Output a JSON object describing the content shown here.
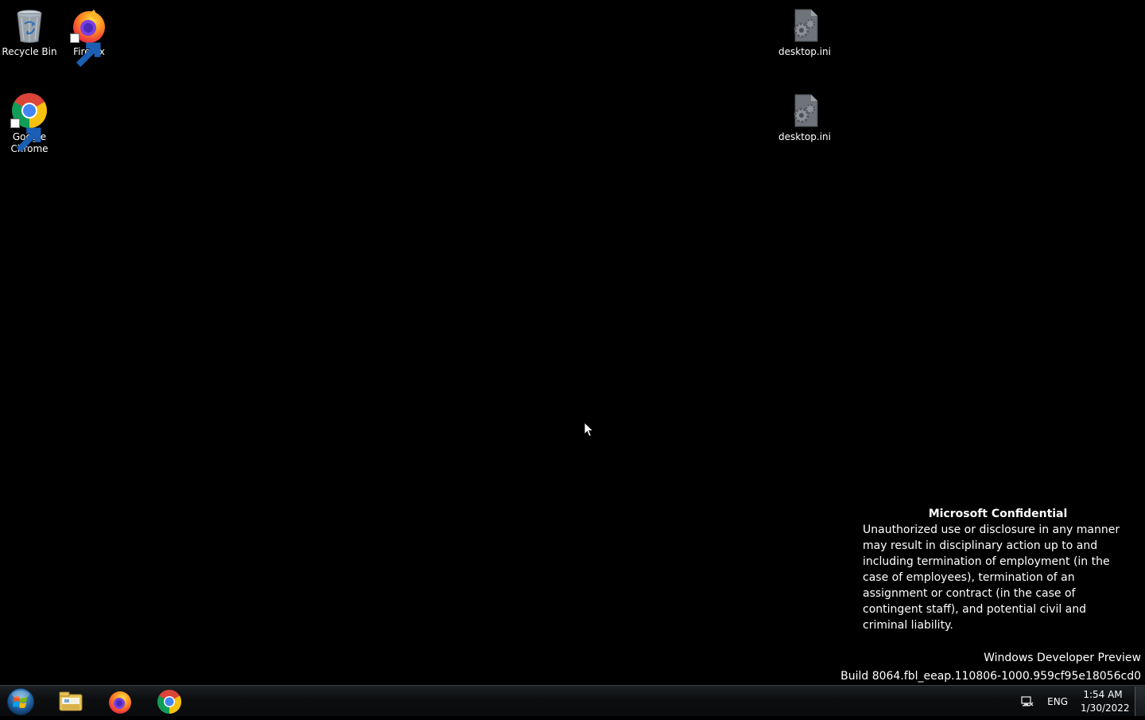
{
  "desktop_icons": {
    "recycle_bin": "Recycle Bin",
    "firefox": "Firefox",
    "google_chrome": "Google Chrome",
    "desktop_ini_1": "desktop.ini",
    "desktop_ini_2": "desktop.ini"
  },
  "watermark": {
    "title": "Microsoft Confidential",
    "body": "Unauthorized use or disclosure in any manner may result in disciplinary action up to and including termination of employment (in the case of employees), termination of an assignment or contract (in the case of contingent staff), and potential civil and criminal liability."
  },
  "build_info": {
    "edition": "Windows Developer Preview",
    "build": "Build 8064.fbl_eeap.110806-1000.959cf95e18056cd0"
  },
  "taskbar": {
    "pinned": [
      "file-explorer-icon",
      "firefox-icon",
      "chrome-icon"
    ],
    "tray": {
      "language": "ENG",
      "time": "1:54 AM",
      "date": "1/30/2022"
    }
  },
  "colors": {
    "desktop_background": "#000000",
    "taskbar": "#0d0f11",
    "text": "#ffffff"
  }
}
